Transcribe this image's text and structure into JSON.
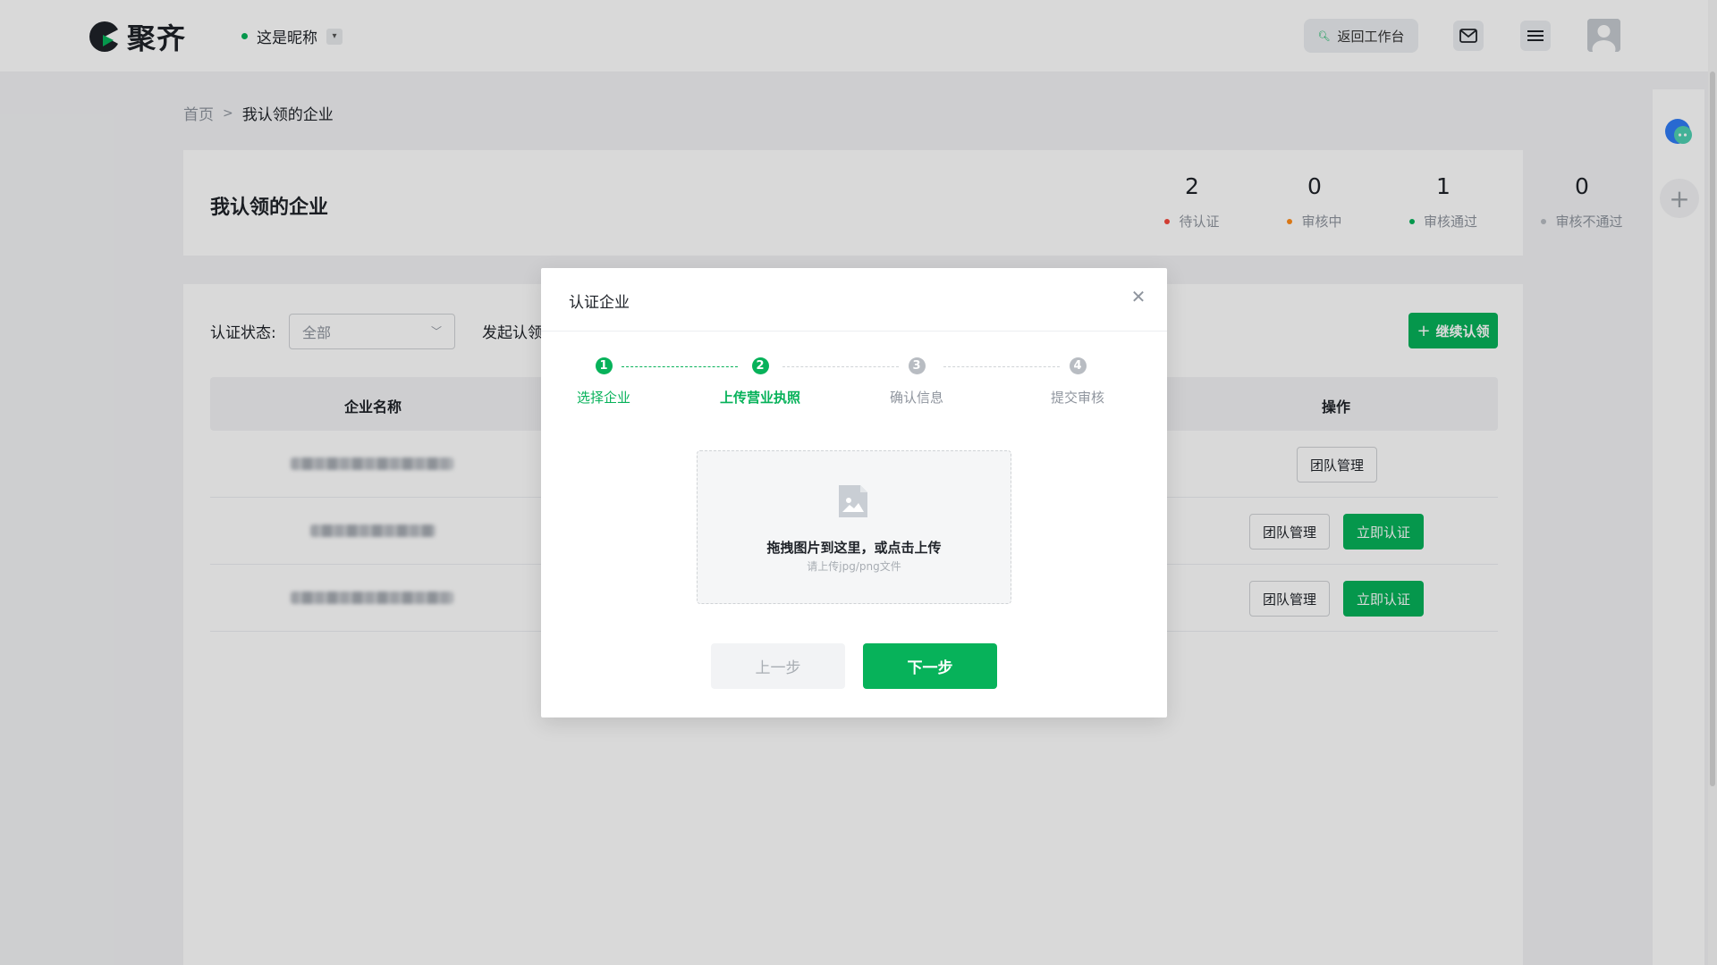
{
  "header": {
    "logo_text": "聚齐",
    "nickname": "这是昵称",
    "back_label": "返回工作台",
    "icons": [
      "mail-icon",
      "menu-icon",
      "avatar"
    ]
  },
  "breadcrumb": {
    "home": "首页",
    "separator": ">",
    "current": "我认领的企业"
  },
  "stats": {
    "title": "我认领的企业",
    "items": [
      {
        "count": "2",
        "label": "待认证",
        "color": "#f5483b"
      },
      {
        "count": "0",
        "label": "审核中",
        "color": "#ff8c1a"
      },
      {
        "count": "1",
        "label": "审核通过",
        "color": "#07b25a"
      },
      {
        "count": "0",
        "label": "审核不通过",
        "color": "#b8bcc2"
      }
    ]
  },
  "list": {
    "filter_label": "认证状态:",
    "filter_value": "全部",
    "filter2_label": "发起认领",
    "continue_label": "继续认领",
    "columns": {
      "name": "企业名称",
      "actions": "操作"
    },
    "rows": [
      {
        "actions": [
          "团队管理"
        ]
      },
      {
        "actions": [
          "团队管理",
          "立即认证"
        ]
      },
      {
        "actions": [
          "团队管理",
          "立即认证"
        ]
      }
    ]
  },
  "modal": {
    "title": "认证企业",
    "steps": [
      {
        "num": "1",
        "label": "选择企业",
        "state": "done"
      },
      {
        "num": "2",
        "label": "上传营业执照",
        "state": "active"
      },
      {
        "num": "3",
        "label": "确认信息",
        "state": "pending"
      },
      {
        "num": "4",
        "label": "提交审核",
        "state": "pending"
      }
    ],
    "upload_text": "拖拽图片到这里，或点击上传",
    "upload_hint": "请上传jpg/png文件",
    "prev_label": "上一步",
    "next_label": "下一步"
  },
  "colors": {
    "accent": "#07b25a",
    "pending": "#b8bcc2"
  }
}
